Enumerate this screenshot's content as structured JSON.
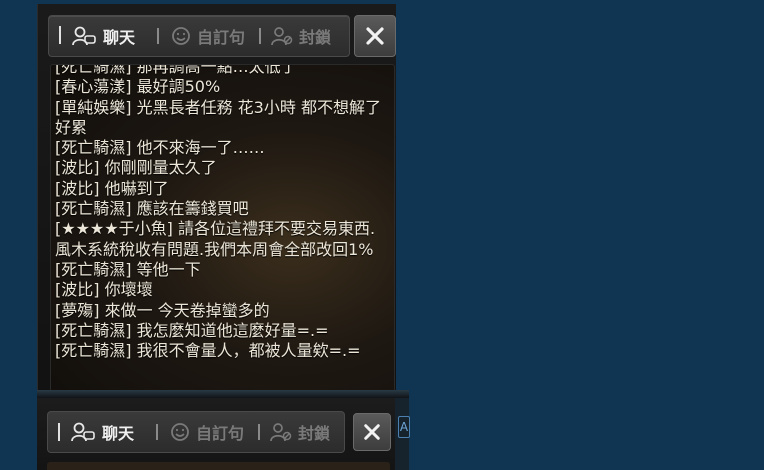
{
  "tabs": [
    {
      "label": "聊天",
      "icon": "chat-people-icon",
      "active": true
    },
    {
      "label": "自訂句",
      "icon": "smiley-icon",
      "active": false
    },
    {
      "label": "封鎖",
      "icon": "block-user-icon",
      "active": false
    }
  ],
  "close_icon": "close-icon",
  "messages": [
    {
      "name": "[死亡騎濕]",
      "text": " 那再調高一點…太低了"
    },
    {
      "name": "[春心蕩漾]",
      "text": " 最好調50%"
    },
    {
      "name": "[單純娛樂]",
      "text": " 光黑長者任務 花3小時 都不想解了 好累"
    },
    {
      "name": "[死亡騎濕]",
      "text": " 他不來海一了……"
    },
    {
      "name": "[波比]",
      "text": " 你剛剛量太久了"
    },
    {
      "name": "[波比]",
      "text": " 他嚇到了"
    },
    {
      "name": "[死亡騎濕]",
      "text": " 應該在籌錢買吧"
    },
    {
      "name": "[★★★★于小魚]",
      "text": " 請各位這禮拜不要交易東西.風木系統稅收有問題.我們本周會全部改回1%"
    },
    {
      "name": "[死亡騎濕]",
      "text": " 等他一下"
    },
    {
      "name": "[波比]",
      "text": " 你壞壞"
    },
    {
      "name": "[夢殤]",
      "text": " 來做一 今天卷掉蠻多的"
    },
    {
      "name": "[死亡騎濕]",
      "text": " 我怎麼知道他這麼好量=.="
    },
    {
      "name": "[死亡騎濕]",
      "text": " 我很不會量人，都被人量欸=.="
    }
  ],
  "panel2_tabs": [
    {
      "label": "聊天",
      "icon": "chat-people-icon",
      "active": true
    },
    {
      "label": "自訂句",
      "icon": "smiley-icon",
      "active": false
    },
    {
      "label": "封鎖",
      "icon": "block-user-icon",
      "active": false
    }
  ]
}
